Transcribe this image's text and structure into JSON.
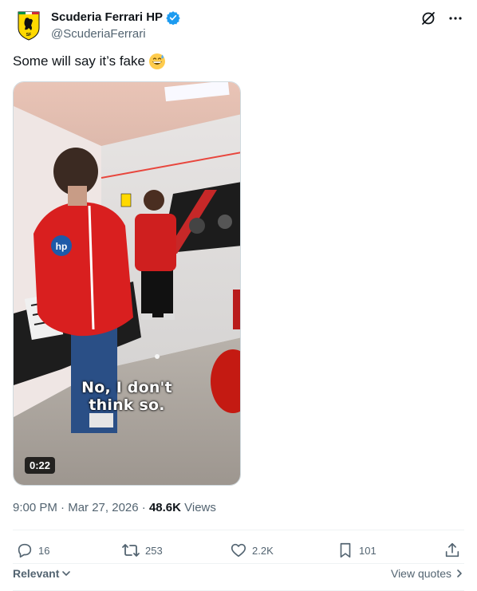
{
  "author": {
    "display_name": "Scuderia Ferrari HP",
    "handle": "@ScuderiaFerrari"
  },
  "tweet": {
    "text": "Some will say it’s fake",
    "emoji": "grinning-sweat-emoji"
  },
  "media": {
    "subtitle_line1": "No, I don't",
    "subtitle_line2": "think so.",
    "duration": "0:22"
  },
  "meta": {
    "time": "9:00 PM",
    "separator1": " · ",
    "date": "Mar 27, 2026",
    "separator2": " · ",
    "views_count": "48.6K",
    "views_label": " Views"
  },
  "actions": {
    "replies": "16",
    "reposts": "253",
    "likes": "2.2K",
    "bookmarks": "101"
  },
  "footer": {
    "sort_label": "Relevant",
    "quotes_label": "View quotes"
  },
  "colors": {
    "verified": "#1d9bf0",
    "ferrari_red": "#d40000",
    "muted_text": "#536471"
  }
}
